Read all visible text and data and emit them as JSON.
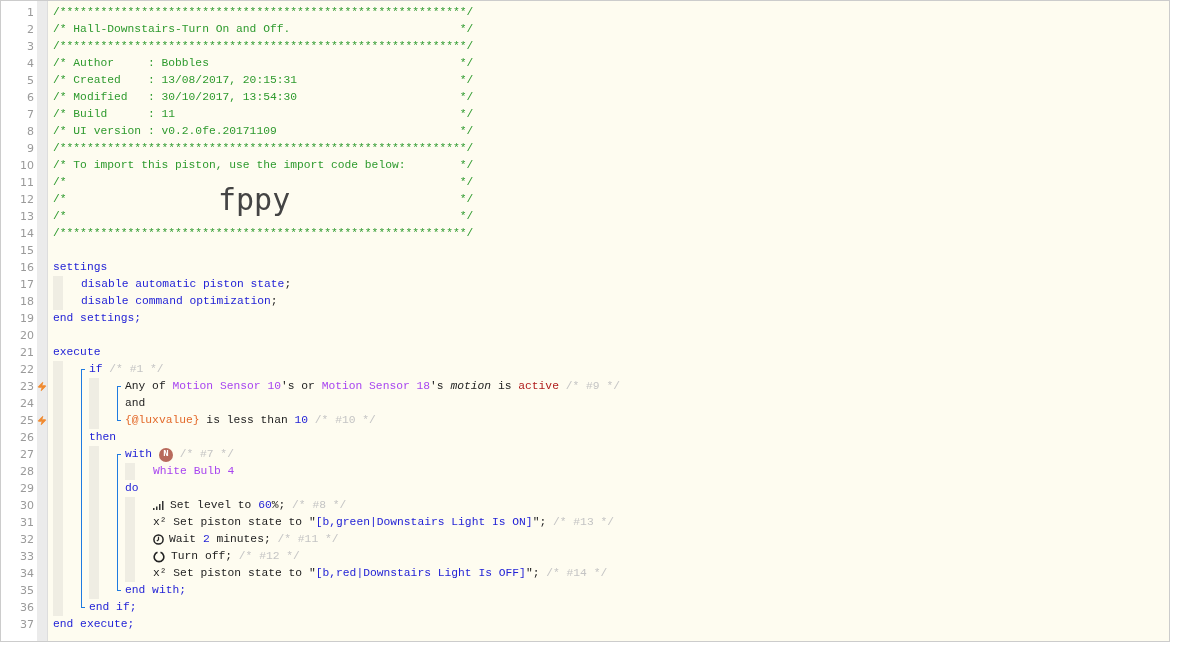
{
  "lines": [
    {
      "n": "1",
      "kind": "box",
      "text": "/************************************************************/"
    },
    {
      "n": "2",
      "kind": "box",
      "text": "/* Hall-Downstairs-Turn On and Off.",
      "end": "*/"
    },
    {
      "n": "3",
      "kind": "box",
      "text": "/************************************************************/"
    },
    {
      "n": "4",
      "kind": "box",
      "text": "/* Author     : Bobbles",
      "end": "*/"
    },
    {
      "n": "5",
      "kind": "box",
      "text": "/* Created    : 13/08/2017, 20:15:31",
      "end": "*/"
    },
    {
      "n": "6",
      "kind": "box",
      "text": "/* Modified   : 30/10/2017, 13:54:30",
      "end": "*/"
    },
    {
      "n": "7",
      "kind": "box",
      "text": "/* Build      : 11",
      "end": "*/"
    },
    {
      "n": "8",
      "kind": "box",
      "text": "/* UI version : v0.2.0fe.20171109",
      "end": "*/"
    },
    {
      "n": "9",
      "kind": "box",
      "text": "/************************************************************/"
    },
    {
      "n": "10",
      "kind": "box",
      "text": "/* To import this piston, use the import code below:",
      "end": "*/"
    },
    {
      "n": "11",
      "kind": "box",
      "text": "/*",
      "end": "*/"
    },
    {
      "n": "12",
      "kind": "box",
      "text": "/*",
      "end": "*/",
      "import_code": "fppy"
    },
    {
      "n": "13",
      "kind": "box",
      "text": "/*",
      "end": "*/"
    },
    {
      "n": "14",
      "kind": "box",
      "text": "/************************************************************/"
    },
    {
      "n": "15"
    },
    {
      "n": "16",
      "segments": [
        {
          "text": "settings",
          "kind": "keyword"
        }
      ],
      "children": [
        {
          "n": "17",
          "segments": [
            {
              "text": "disable automatic piston state",
              "kind": "keyword"
            },
            {
              "text": ";",
              "kind": "plain"
            }
          ]
        },
        {
          "n": "18",
          "segments": [
            {
              "text": "disable command optimization",
              "kind": "keyword"
            },
            {
              "text": ";",
              "kind": "plain"
            }
          ]
        }
      ]
    },
    {
      "n": "19",
      "segments": [
        {
          "text": "end settings;",
          "kind": "keyword"
        }
      ]
    },
    {
      "n": "20"
    },
    {
      "n": "21",
      "segments": [
        {
          "text": "execute",
          "kind": "keyword"
        }
      ],
      "children": [
        {
          "kind": "bracket",
          "children": [
            {
              "n": "22",
              "segments": [
                {
                  "text": "if",
                  "kind": "keyword"
                },
                {
                  "text": " /* #1 */",
                  "kind": "comment"
                }
              ],
              "children": [
                {
                  "kind": "bracket",
                  "children": [
                    {
                      "n": "23",
                      "trigger": true,
                      "segments": [
                        {
                          "text": "Any of ",
                          "kind": "plain"
                        },
                        {
                          "text": "Motion Sensor 10",
                          "kind": "device"
                        },
                        {
                          "text": "'s or ",
                          "kind": "plain"
                        },
                        {
                          "text": "Motion Sensor 18",
                          "kind": "device"
                        },
                        {
                          "text": "'s ",
                          "kind": "plain"
                        },
                        {
                          "text": "motion",
                          "kind": "attribute"
                        },
                        {
                          "text": " is ",
                          "kind": "plain"
                        },
                        {
                          "text": "active",
                          "kind": "value"
                        },
                        {
                          "text": " /* #9 */",
                          "kind": "comment"
                        }
                      ]
                    },
                    {
                      "n": "24",
                      "segments": [
                        {
                          "text": "and",
                          "kind": "plain"
                        }
                      ]
                    },
                    {
                      "n": "25",
                      "trigger": true,
                      "segments": [
                        {
                          "text": "{@luxvalue}",
                          "kind": "variable"
                        },
                        {
                          "text": " is less than ",
                          "kind": "plain"
                        },
                        {
                          "text": "10",
                          "kind": "number"
                        },
                        {
                          "text": " /* #10 */",
                          "kind": "comment"
                        }
                      ]
                    }
                  ]
                }
              ]
            },
            {
              "n": "26",
              "segments": [
                {
                  "text": "then",
                  "kind": "keyword"
                }
              ],
              "children": [
                {
                  "kind": "bracket",
                  "children": [
                    {
                      "n": "27",
                      "segments": [
                        {
                          "text": "with ",
                          "kind": "keyword"
                        },
                        {
                          "text": "N",
                          "kind": "badge"
                        },
                        {
                          "text": " /* #7 */",
                          "kind": "comment"
                        }
                      ],
                      "children": [
                        {
                          "n": "28",
                          "segments": [
                            {
                              "text": "White Bulb 4",
                              "kind": "device"
                            }
                          ]
                        }
                      ]
                    },
                    {
                      "n": "29",
                      "segments": [
                        {
                          "text": "do",
                          "kind": "keyword"
                        }
                      ],
                      "children": [
                        {
                          "n": "30",
                          "kind": "level",
                          "segments": [
                            {
                              "text": "Set level to ",
                              "kind": "plain"
                            },
                            {
                              "text": "60",
                              "kind": "number"
                            },
                            {
                              "text": "%; ",
                              "kind": "plain"
                            },
                            {
                              "text": "/* #8 */",
                              "kind": "comment"
                            }
                          ]
                        },
                        {
                          "n": "31",
                          "segments": [
                            {
                              "text": "x² Set piston state to \"",
                              "kind": "plain"
                            },
                            {
                              "text": "[b,green|Downstairs Light Is ON]",
                              "kind": "string"
                            },
                            {
                              "text": "\"; ",
                              "kind": "plain"
                            },
                            {
                              "text": "/* #13 */",
                              "kind": "comment"
                            }
                          ]
                        },
                        {
                          "n": "32",
                          "kind": "wait",
                          "segments": [
                            {
                              "text": "Wait ",
                              "kind": "plain"
                            },
                            {
                              "text": "2",
                              "kind": "number"
                            },
                            {
                              "text": " minutes; ",
                              "kind": "plain"
                            },
                            {
                              "text": "/* #11 */",
                              "kind": "comment"
                            }
                          ]
                        },
                        {
                          "n": "33",
                          "kind": "turn_off",
                          "segments": [
                            {
                              "text": "Turn off; ",
                              "kind": "plain"
                            },
                            {
                              "text": "/* #12 */",
                              "kind": "comment"
                            }
                          ]
                        },
                        {
                          "n": "34",
                          "segments": [
                            {
                              "text": "x² Set piston state to \"",
                              "kind": "plain"
                            },
                            {
                              "text": "[b,red|Downstairs Light Is OFF]",
                              "kind": "string"
                            },
                            {
                              "text": "\"; ",
                              "kind": "plain"
                            },
                            {
                              "text": "/* #14 */",
                              "kind": "comment"
                            }
                          ]
                        }
                      ]
                    },
                    {
                      "n": "35",
                      "segments": [
                        {
                          "text": "end with;",
                          "kind": "keyword"
                        }
                      ]
                    }
                  ]
                }
              ]
            },
            {
              "n": "36",
              "segments": [
                {
                  "text": "end if;",
                  "kind": "keyword"
                }
              ]
            }
          ]
        }
      ]
    },
    {
      "n": "37",
      "segments": [
        {
          "text": "end execute;",
          "kind": "keyword"
        }
      ]
    }
  ]
}
